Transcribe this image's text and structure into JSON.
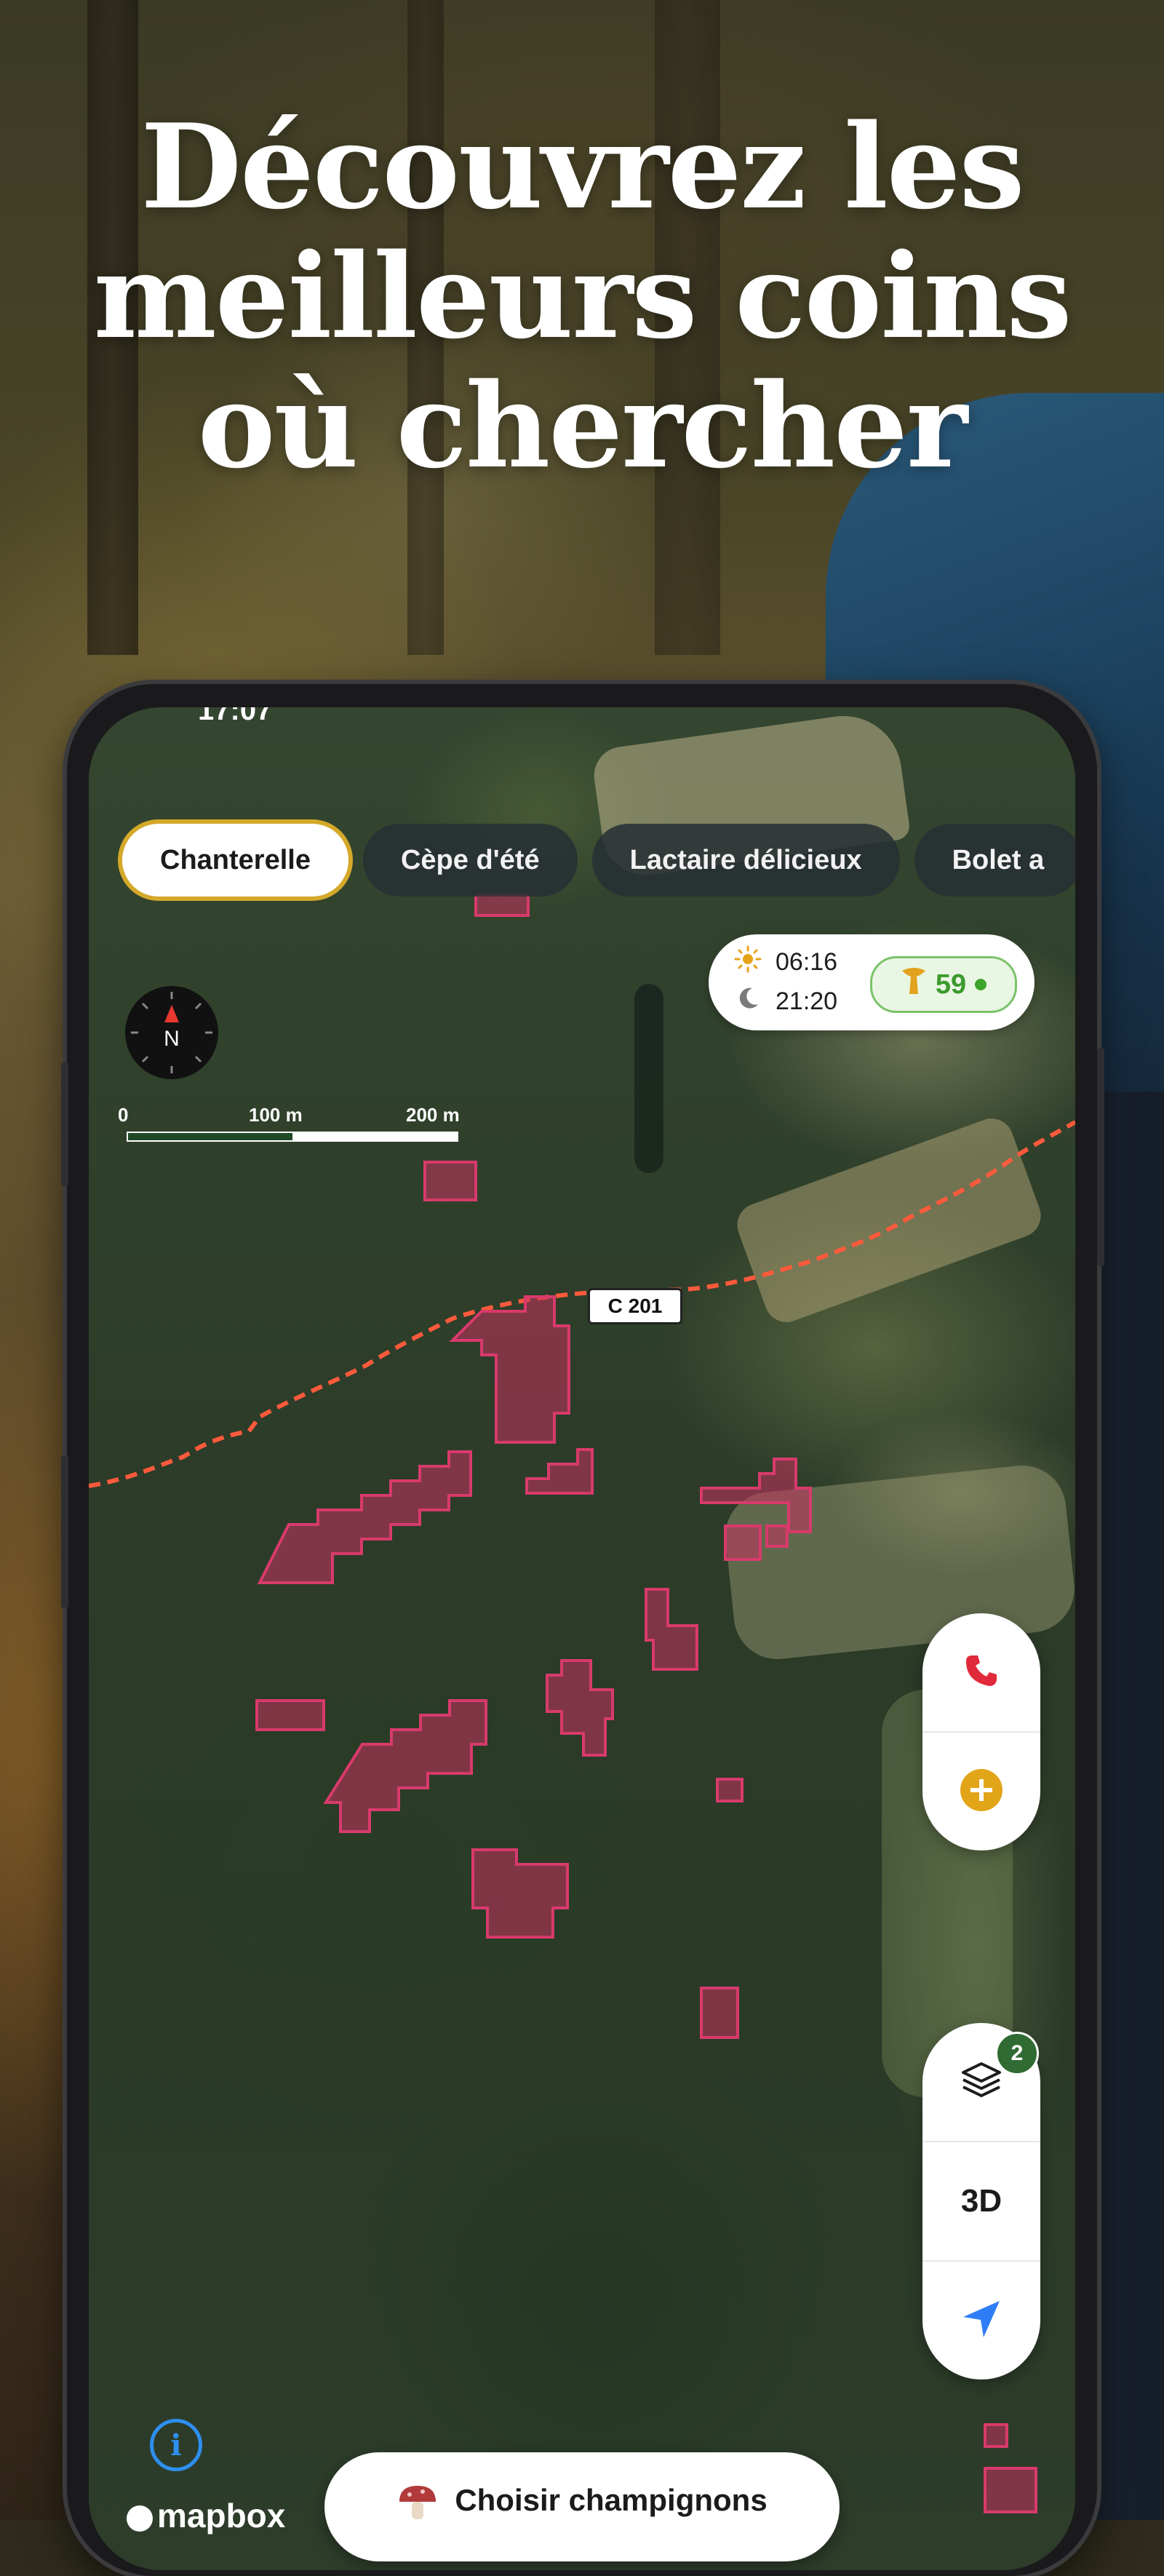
{
  "headline": {
    "lines": [
      "Découvrez les",
      "meilleurs coins",
      "où chercher"
    ]
  },
  "status_bar": {
    "time": "17:07"
  },
  "chips": [
    {
      "label": "Chanterelle",
      "active": true
    },
    {
      "label": "Cèpe d'été",
      "active": false
    },
    {
      "label": "Lactaire délicieux",
      "active": false
    },
    {
      "label": "Bolet a",
      "active": false
    }
  ],
  "sun_info": {
    "sunrise": "06:16",
    "sunset": "21:20",
    "score": "59"
  },
  "compass": {
    "letter": "N"
  },
  "scale": {
    "labels": [
      "0",
      "100 m",
      "200 m"
    ]
  },
  "route": {
    "label": "C 201"
  },
  "controls": {
    "layers_badge": "2",
    "three_d_label": "3D"
  },
  "bottom": {
    "choose_button": "Choisir champignons",
    "mapbox_logo": "mapbox"
  },
  "colors": {
    "chip_active_border": "#d4a82a",
    "route_line": "#ff5a3c",
    "hotspot_fill": "#c6325f",
    "score_green": "#3d9a2d",
    "phone_icon": "#e0293a",
    "add_icon": "#e2a418",
    "locate_icon": "#2e7df6"
  },
  "icons": [
    "compass-icon",
    "sunrise-icon",
    "sunset-icon",
    "mushroom-score-icon",
    "phone-icon",
    "add-icon",
    "layers-icon",
    "locate-icon",
    "info-icon",
    "mushroom-icon"
  ]
}
